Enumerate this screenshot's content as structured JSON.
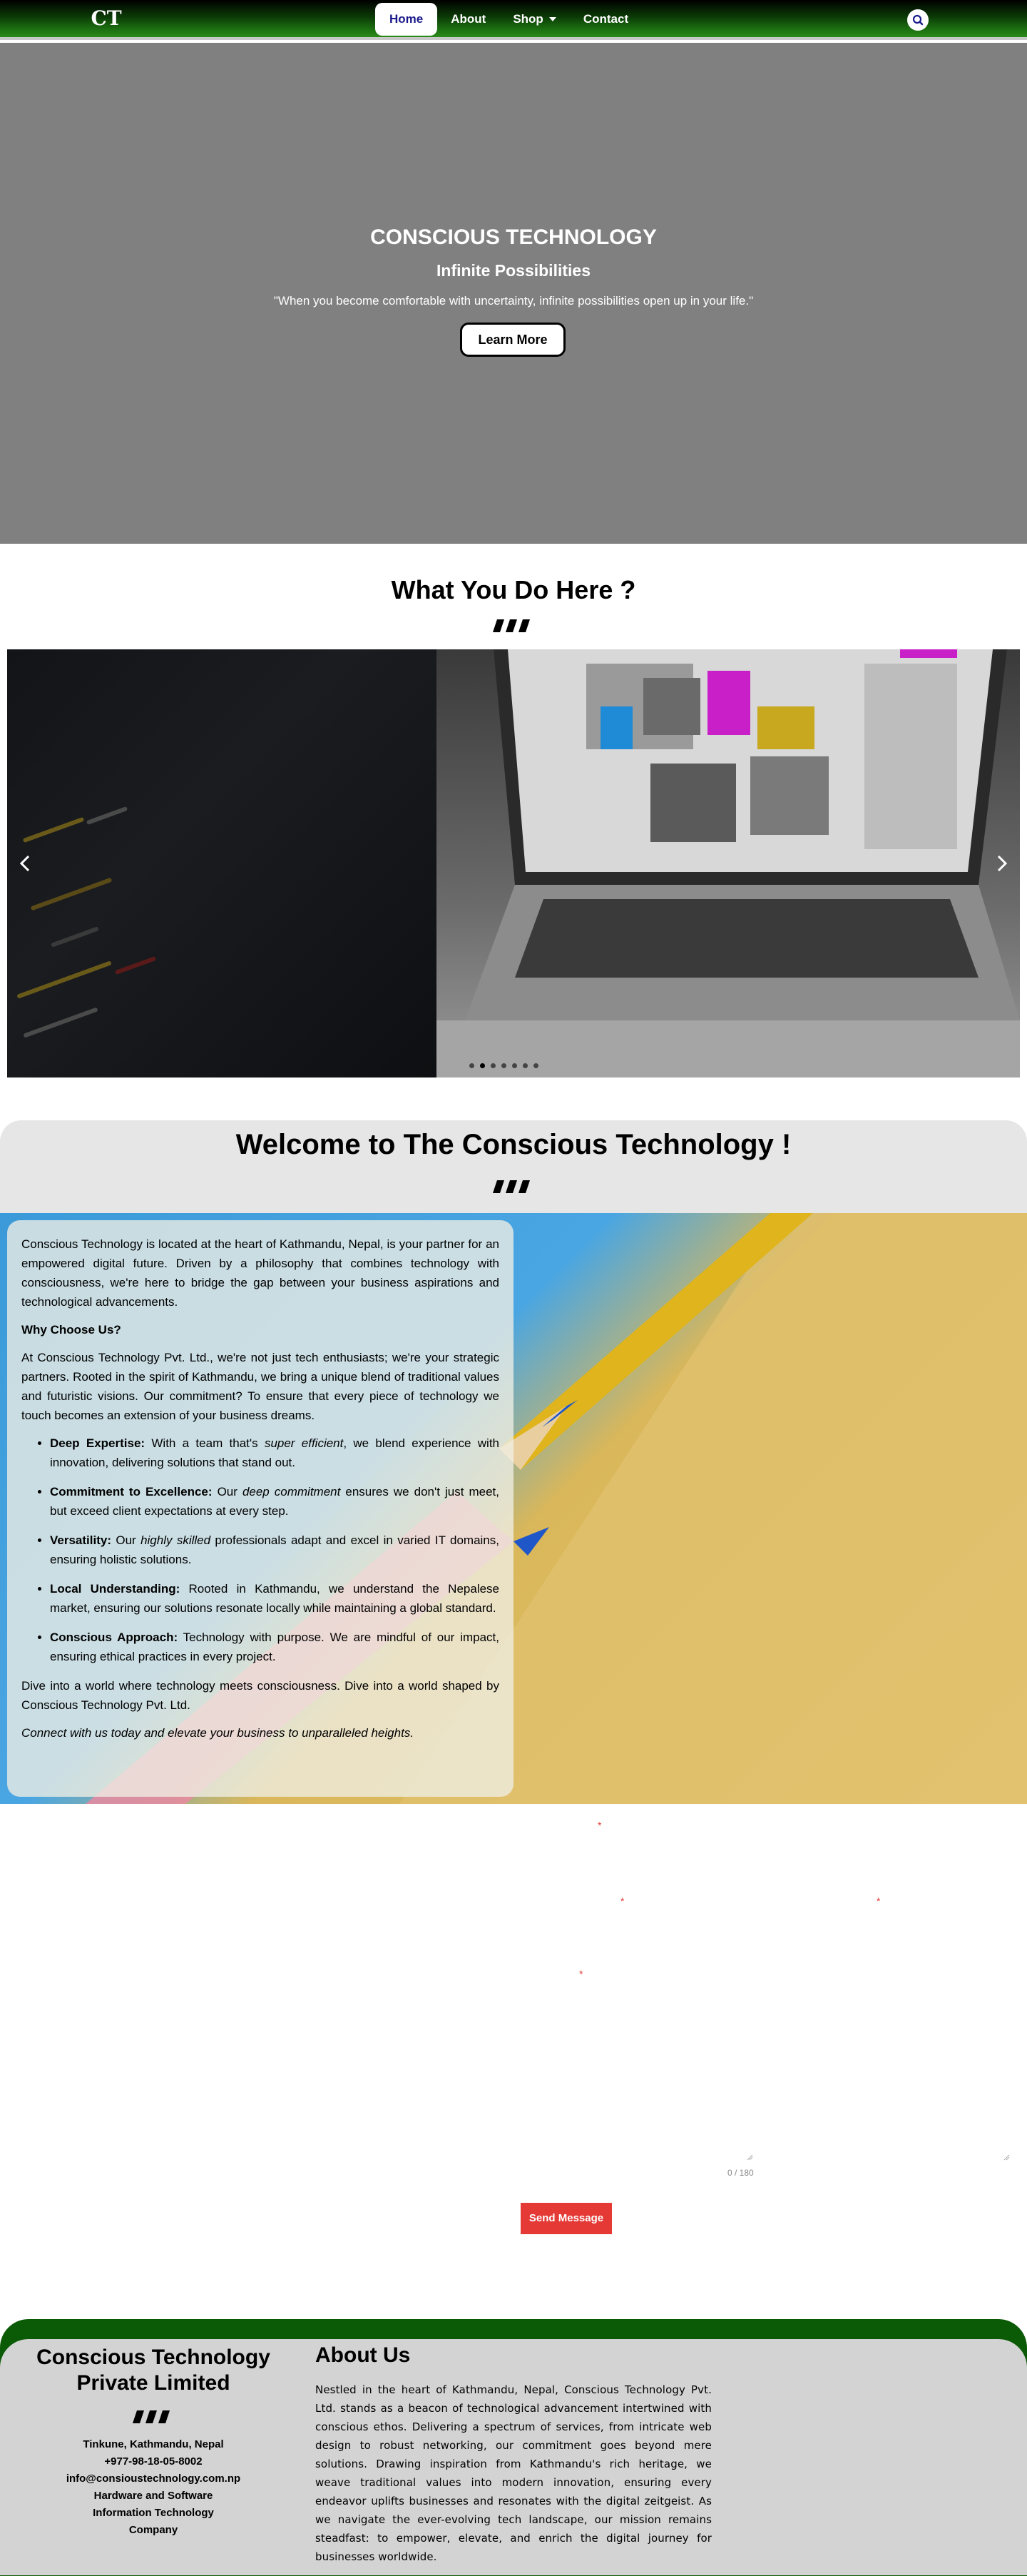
{
  "nav": {
    "logo_text": "CT",
    "items": [
      {
        "label": "Home",
        "active": true
      },
      {
        "label": "About",
        "active": false
      },
      {
        "label": "Shop",
        "active": false,
        "has_dropdown": true
      },
      {
        "label": "Contact",
        "active": false
      }
    ],
    "search_icon": "search-icon"
  },
  "hero": {
    "title": "CONSCIOUS TECHNOLOGY",
    "subtitle": "Infinite Possibilities",
    "quote": "\"When you become comfortable with uncertainty, infinite possibilities open up in your life.\"",
    "button_label": "Learn More"
  },
  "what": {
    "title": "What You Do Here ?",
    "slider_left_icon": "chevron-left-icon",
    "slider_right_icon": "chevron-right-icon",
    "slide_count": 7,
    "active_slide": 1
  },
  "welcome": {
    "title": "Welcome to The Conscious Technology !",
    "intro": "Conscious Technology is located at the heart of Kathmandu, Nepal, is your partner for an empowered digital future. Driven by a philosophy that combines technology with consciousness, we're here to bridge the gap between your business aspirations and technological advancements.",
    "why_heading": "Why Choose Us?",
    "why_text": "At Conscious Technology Pvt. Ltd., we're not just tech enthusiasts; we're your strategic partners. Rooted in the spirit of Kathmandu, we bring a unique blend of traditional values and futuristic visions. Our commitment? To ensure that every piece of technology we touch becomes an extension of your business dreams.",
    "points": [
      {
        "label": "Deep Expertise:",
        "pre": " With a team that's ",
        "em": "super efficient",
        "post": ", we blend experience with innovation, delivering solutions that stand out."
      },
      {
        "label": "Commitment to Excellence:",
        "pre": " Our ",
        "em": "deep commitment",
        "post": " ensures we don't just meet, but exceed client expectations at every step."
      },
      {
        "label": "Versatility:",
        "pre": " Our ",
        "em": "highly skilled",
        "post": " professionals adapt and excel in varied IT domains, ensuring holistic solutions."
      },
      {
        "label": "Local Understanding:",
        "pre": " Rooted in Kathmandu, we understand the Nepalese market, ensuring our solutions resonate locally while maintaining a global standard.",
        "em": "",
        "post": ""
      },
      {
        "label": "Conscious Approach:",
        "pre": " Technology with purpose. We are mindful of our impact, ensuring ethical practices in every project.",
        "em": "",
        "post": ""
      }
    ],
    "closing": "Dive into a world where technology meets consciousness. Dive into a world shaped by Conscious Technology Pvt. Ltd.",
    "cta": "Connect with us today and elevate your business to unparalleled heights."
  },
  "form": {
    "required_mark": "*",
    "counter": "0 / 180",
    "send_label": "Send Message"
  },
  "footer": {
    "company": "Conscious Technology Private Limited",
    "address": "Tinkune, Kathmandu, Nepal",
    "phone": "+977-98-18-05-8002",
    "email": "info@consioustechnology.com.np",
    "tagline1": "Hardware and Software",
    "tagline2": "Information Technology",
    "tagline3": "Company",
    "about_title": "About Us",
    "about_text": "Nestled in the heart of Kathmandu, Nepal, Conscious Technology Pvt. Ltd. stands as a beacon of technological advancement intertwined with conscious ethos. Delivering a spectrum of services, from intricate web design to robust networking, our commitment goes beyond mere solutions. Drawing inspiration from Kathmandu's rich heritage, we weave traditional values into modern innovation, ensuring every endeavor uplifts businesses and resonates with the digital zeitgeist. As we navigate the ever-evolving tech landscape, our mission remains steadfast: to empower, elevate, and enrich the digital journey for businesses worldwide."
  },
  "colors": {
    "nav_green": "#1a6b10",
    "active_link": "#1a1a8c",
    "hero_bg": "#808080",
    "send_button": "#e53935",
    "footer_bg": "#d3d3d3"
  }
}
